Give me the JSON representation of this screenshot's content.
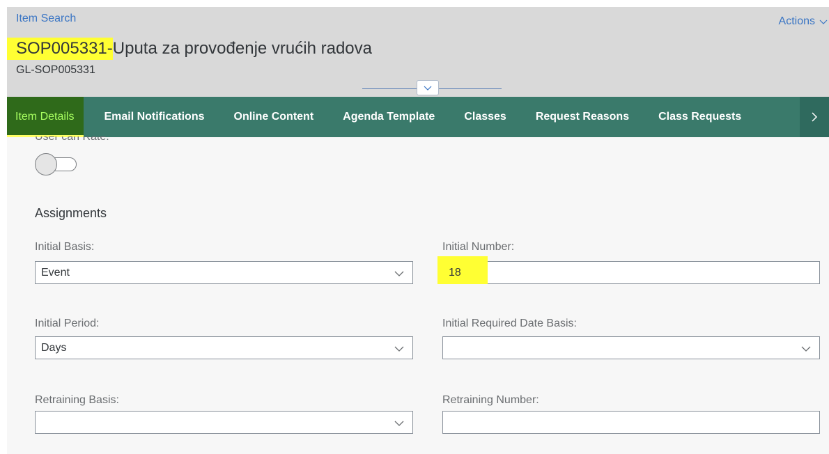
{
  "header": {
    "breadcrumb": "Item Search",
    "actions_label": "Actions",
    "title_id": "SOP005331-",
    "title_rest": "Uputa za provođenje vrućih radova",
    "subtitle": "GL-SOP005331"
  },
  "tabs": [
    {
      "label": "Item Details",
      "active": true
    },
    {
      "label": "Email Notifications"
    },
    {
      "label": "Online Content"
    },
    {
      "label": "Agenda Template"
    },
    {
      "label": "Classes"
    },
    {
      "label": "Request Reasons"
    },
    {
      "label": "Class Requests"
    }
  ],
  "content": {
    "cut_label": "User can Rate:",
    "section_title": "Assignments",
    "fields": {
      "initial_basis": {
        "label": "Initial Basis:",
        "value": "Event"
      },
      "initial_number": {
        "label": "Initial Number:",
        "value": "18"
      },
      "initial_period": {
        "label": "Initial Period:",
        "value": "Days"
      },
      "initial_required_date_basis": {
        "label": "Initial Required Date Basis:",
        "value": ""
      },
      "retraining_basis": {
        "label": "Retraining Basis:",
        "value": ""
      },
      "retraining_number": {
        "label": "Retraining Number:",
        "value": ""
      }
    }
  },
  "colors": {
    "tab_bar": "#3a7a6b",
    "highlight": "#ffff33",
    "link": "#3a75c4"
  },
  "icons": {
    "actions": "chevron-down-icon",
    "collapse": "chevron-down-icon",
    "tabs_more": "chevron-right-icon",
    "dropdown": "chevron-down-icon"
  }
}
